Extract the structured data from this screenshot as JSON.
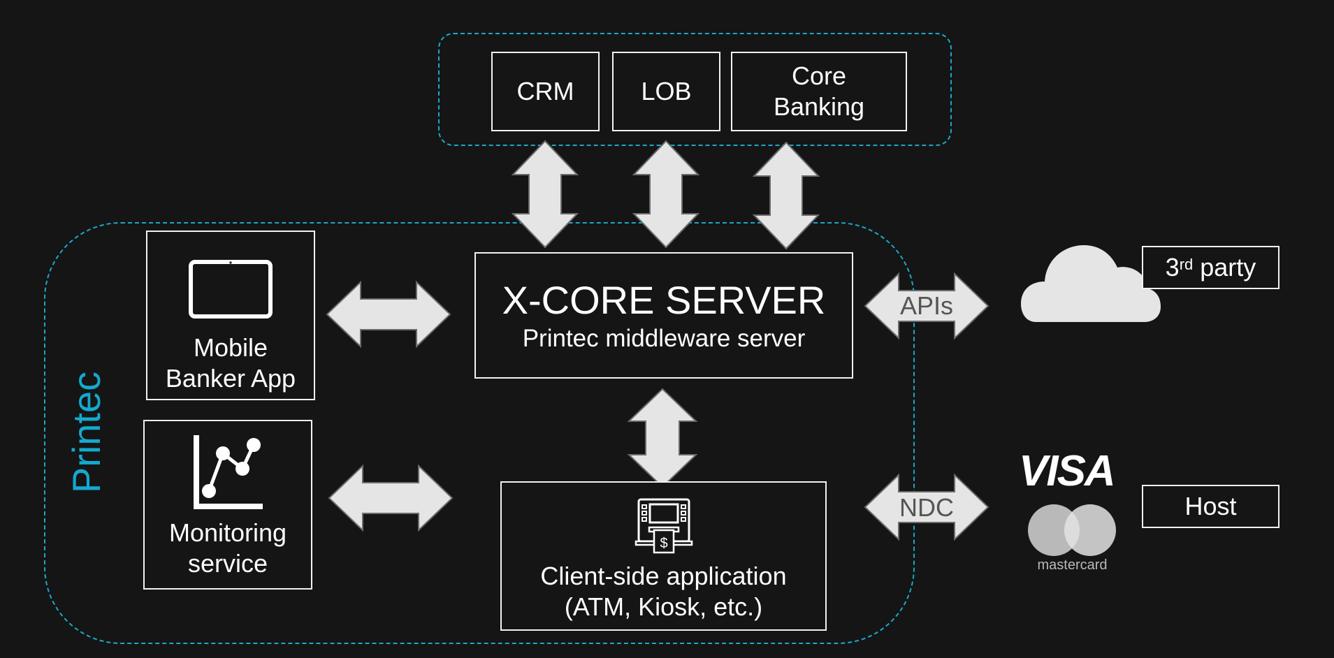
{
  "external_systems": {
    "items": [
      {
        "label_lines": [
          "CRM"
        ]
      },
      {
        "label_lines": [
          "LOB"
        ]
      },
      {
        "label_lines": [
          "Core",
          "Banking"
        ]
      }
    ]
  },
  "printec_group": {
    "label": "Printec"
  },
  "xcore": {
    "title": "X-CORE SERVER",
    "subtitle": "Printec middleware server"
  },
  "mobile_app": {
    "icon": "tablet-icon",
    "label_lines": [
      "Mobile",
      "Banker App"
    ]
  },
  "monitoring": {
    "icon": "line-chart-icon",
    "label_lines": [
      "Monitoring",
      "service"
    ]
  },
  "client_app": {
    "icon": "atm-icon",
    "label_lines": [
      "Client-side application",
      "(ATM, Kiosk, etc.)"
    ]
  },
  "connections": {
    "apis_label": "APIs",
    "ndc_label": "NDC"
  },
  "third_party": {
    "icon": "cloud-icon",
    "label_main": "3",
    "label_sup": "rd",
    "label_rest": " party"
  },
  "host": {
    "visa_logo": "VISA",
    "mastercard_logo": "mastercard",
    "label": "Host"
  },
  "colors": {
    "background": "#151515",
    "accent": "#14a9cf",
    "box_border": "#f2f2f2",
    "arrow_fill": "#e6e5e6",
    "arrow_stroke": "#6b6b6b"
  }
}
